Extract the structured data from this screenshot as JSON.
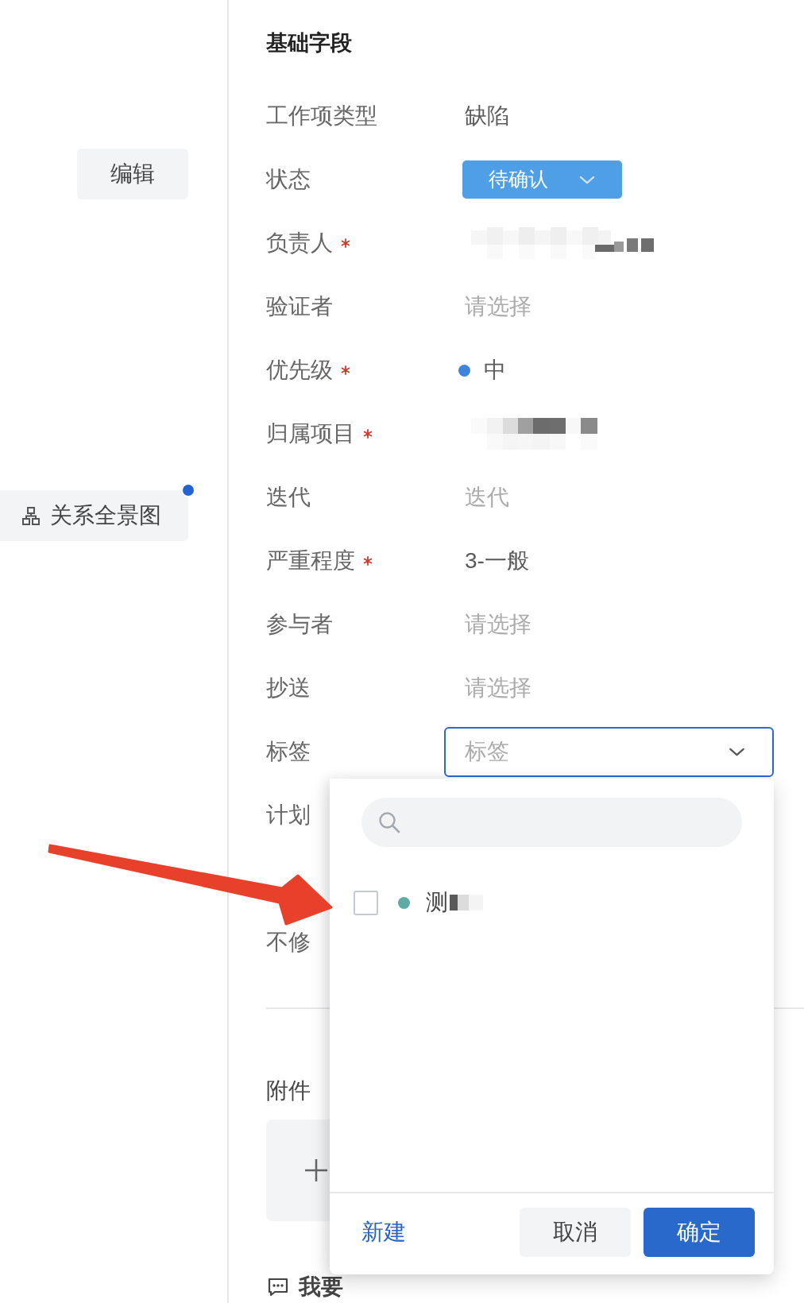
{
  "sidebar": {
    "buttons": [
      {
        "label": "编辑",
        "kind": "text",
        "dot": false
      },
      {
        "label": "关系全景图",
        "kind": "icon_text",
        "dot": true
      }
    ]
  },
  "form": {
    "title": "基础字段",
    "fields": [
      {
        "label": "工作项类型",
        "required": false,
        "kind": "text",
        "value": "缺陷"
      },
      {
        "label": "状态",
        "required": false,
        "kind": "status",
        "value": "待确认"
      },
      {
        "label": "负责人",
        "required": true,
        "kind": "redacted"
      },
      {
        "label": "验证者",
        "required": false,
        "kind": "empty",
        "placeholder": "请选择"
      },
      {
        "label": "优先级",
        "required": true,
        "kind": "priority",
        "value": "中",
        "color": "#3b86dc"
      },
      {
        "label": "归属项目",
        "required": true,
        "kind": "redacted"
      },
      {
        "label": "迭代",
        "required": false,
        "kind": "empty",
        "placeholder": "迭代"
      },
      {
        "label": "严重程度",
        "required": true,
        "kind": "text",
        "value": "3-一般"
      },
      {
        "label": "参与者",
        "required": false,
        "kind": "empty",
        "placeholder": "请选择"
      },
      {
        "label": "抄送",
        "required": false,
        "kind": "empty",
        "placeholder": "请选择"
      },
      {
        "label": "标签",
        "required": false,
        "kind": "select",
        "placeholder": "标签",
        "focused": true
      },
      {
        "label": "计划",
        "kind": "hidden"
      },
      {
        "kind": "covered"
      },
      {
        "label": "不修",
        "kind": "hidden"
      }
    ],
    "attachments": {
      "label": "附件"
    },
    "feedback": {
      "label": "我要"
    }
  },
  "tag_dropdown": {
    "options": [
      {
        "label": "测",
        "checked": false,
        "color": "#5fa9a6",
        "redacted": true
      }
    ],
    "create_link": "新建",
    "buttons": [
      {
        "label": "取消",
        "kind": "secondary"
      },
      {
        "label": "确定",
        "kind": "primary"
      }
    ]
  }
}
